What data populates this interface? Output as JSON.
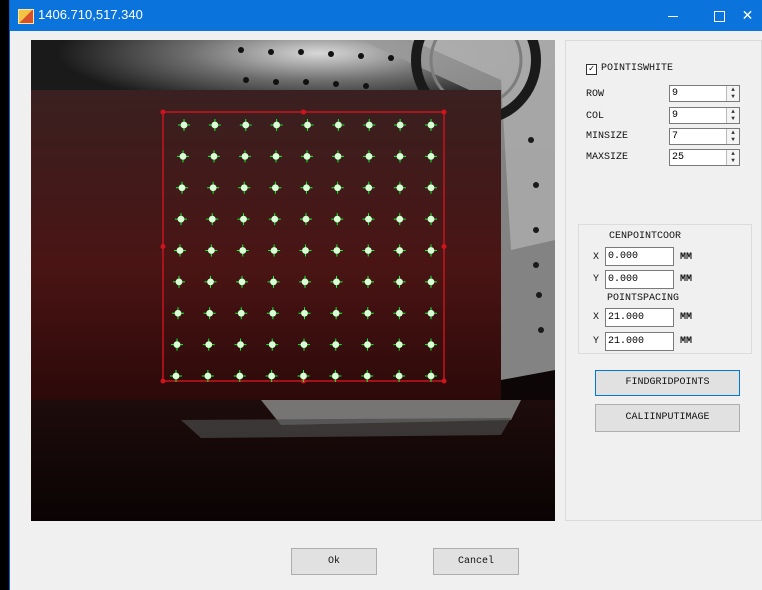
{
  "window": {
    "title": "1406.710,517.340"
  },
  "titlebar": {
    "minimize": "—",
    "maximize": "☐",
    "close": "✕"
  },
  "options": {
    "points_is_white_label": "POINTISWHITE",
    "points_is_white_checked": true,
    "row_label": "ROW",
    "row_value": "9",
    "col_label": "COL",
    "col_value": "9",
    "minsize_label": "MINSIZE",
    "minsize_value": "7",
    "maxsize_label": "MAXSIZE",
    "maxsize_value": "25"
  },
  "center": {
    "group_label": "CENPOINTCOOR",
    "x_label": "X",
    "x_value": "0.000",
    "x_unit": "MM",
    "y_label": "Y",
    "y_value": "0.000",
    "y_unit": "MM"
  },
  "spacing": {
    "group_label": "POINTSPACING",
    "x_label": "X",
    "x_value": "21.000",
    "x_unit": "MM",
    "y_label": "Y",
    "y_value": "21.000",
    "y_unit": "MM"
  },
  "buttons": {
    "find_grid": "FINDGRIDPOINTS",
    "cali_input": "CALIINPUTIMAGE",
    "ok": "Ok",
    "cancel": "Cancel"
  },
  "detection": {
    "rows": 9,
    "cols": 9,
    "point_color": "#00ff2a",
    "box_color": "#d0141e"
  }
}
